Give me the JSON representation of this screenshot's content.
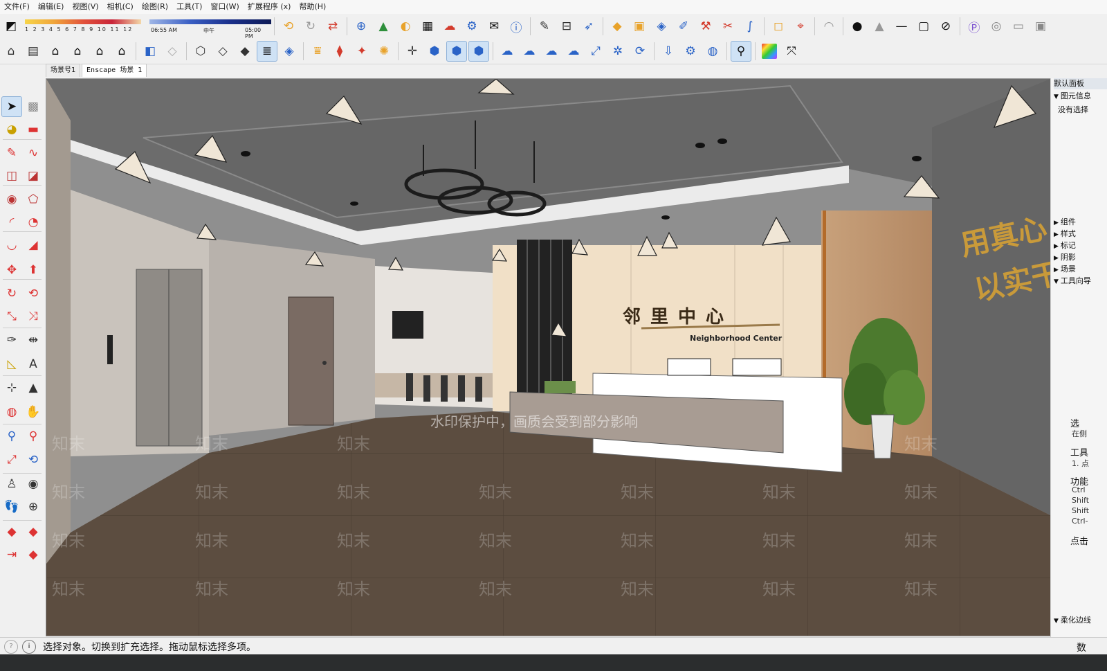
{
  "menu": [
    "文件(F)",
    "编辑(E)",
    "视图(V)",
    "相机(C)",
    "绘图(R)",
    "工具(T)",
    "窗口(W)",
    "扩展程序 (x)",
    "帮助(H)"
  ],
  "shadow": {
    "months": "1 2 3 4 5 6 7 8 9 10 11 12",
    "start_time": "06:55 AM",
    "noon": "中午",
    "end_time": "05:00 PM"
  },
  "tabs": [
    "场景号1",
    "Enscape 场景 1"
  ],
  "active_tab": 1,
  "viewport": {
    "sign_cn": "邻里中心",
    "sign_en": "Neighborhood Center",
    "wall_slogan_1": "用真心",
    "wall_slogan_2": "以实干",
    "watermark_notice": "水印保护中，画质会受到部分影响",
    "watermark_text": "知末"
  },
  "right_panel": {
    "title": "默认面板",
    "entity_info": "图元信息",
    "no_selection": "没有选择",
    "sections": [
      "组件",
      "样式",
      "标记",
      "阴影",
      "场景",
      "工具向导"
    ],
    "guide_heading": "选",
    "guide_sub": "在侧",
    "tool_label": "工具",
    "tool_item": "1. 点",
    "function_label": "功能",
    "shortcuts": [
      "Ctrl",
      "Shift",
      "Shift",
      "Ctrl-"
    ],
    "click_hint": "点击",
    "soft_section": "柔化边线"
  },
  "status": {
    "text": "选择对象。切换到扩充选择。拖动鼠标选择多项。",
    "right": "数"
  },
  "colors": {
    "ceiling": "#6a6a6a",
    "floor": "#5a4b3e",
    "accent_wall": "#f2e2c8",
    "wood": "#c9a47e",
    "sign_gold": "#c99a3a"
  },
  "icons": {
    "toolbar1": [
      "eraser-icon",
      "shadow-slider",
      "enscape-logo-icon",
      "refresh-icon",
      "sync-icon",
      "plus-circle-icon",
      "tree-icon",
      "sun-path-icon",
      "checker-icon",
      "cloud-upload-icon",
      "settings-icon",
      "mail-icon",
      "info-icon",
      "pencil-icon",
      "level-icon",
      "arrow-icon",
      "pipe-icon",
      "box-icon",
      "shape-icon",
      "pen-icon",
      "wrench-icon",
      "cut-icon",
      "curve-icon",
      "square-icon",
      "target-icon",
      "arc-icon",
      "dot-icon",
      "cone-icon",
      "line-icon",
      "frame-icon",
      "eye-slash-icon",
      "profile-icon",
      "orbit-icon",
      "slideshow-icon",
      "camera-icon"
    ],
    "toolbar2": [
      "house-icon",
      "book-icon",
      "home-icon",
      "roof-icon",
      "gable-icon",
      "shed-icon",
      "cube-icon",
      "cube-outline-icon",
      "wire-icon",
      "cube-small-icon",
      "solid-icon",
      "layers-icon",
      "box-blue-icon",
      "stack-icon",
      "stack2-icon",
      "magic-icon",
      "badge-icon",
      "axes-icon",
      "cube3d-icon",
      "cube-active-icon",
      "cube-icon",
      "cloud-icon",
      "cloud2-icon",
      "cloud3-icon",
      "cloud4-icon",
      "resize-icon",
      "network-icon",
      "rotate-icon",
      "download-icon",
      "gear-icon",
      "globe-icon",
      "search-zoom-icon",
      "palette-icon",
      "axis-icon"
    ],
    "left": [
      "select-arrow-icon",
      "component-icon",
      "paint-bucket-icon",
      "eraser-icon",
      "pencil-icon",
      "freehand-icon",
      "rectangle-icon",
      "rotated-rect-icon",
      "circle-icon",
      "polygon-icon",
      "arc-icon",
      "pie-icon",
      "arc3-icon",
      "triangle-icon",
      "move-icon",
      "push-pull-icon",
      "rotate-icon",
      "follow-me-icon",
      "scale-icon",
      "offset-icon",
      "tape-icon",
      "dimension-icon",
      "protractor-icon",
      "text-icon",
      "axes-icon",
      "3d-text-icon",
      "orbit-icon",
      "pan-icon",
      "zoom-icon",
      "zoom-window-icon",
      "zoom-extents-icon",
      "previous-icon",
      "position-camera-icon",
      "look-around-icon",
      "walk-icon",
      "section-icon",
      "ruby-icon",
      "gem-icon",
      "export-icon",
      "gem2-icon"
    ]
  }
}
